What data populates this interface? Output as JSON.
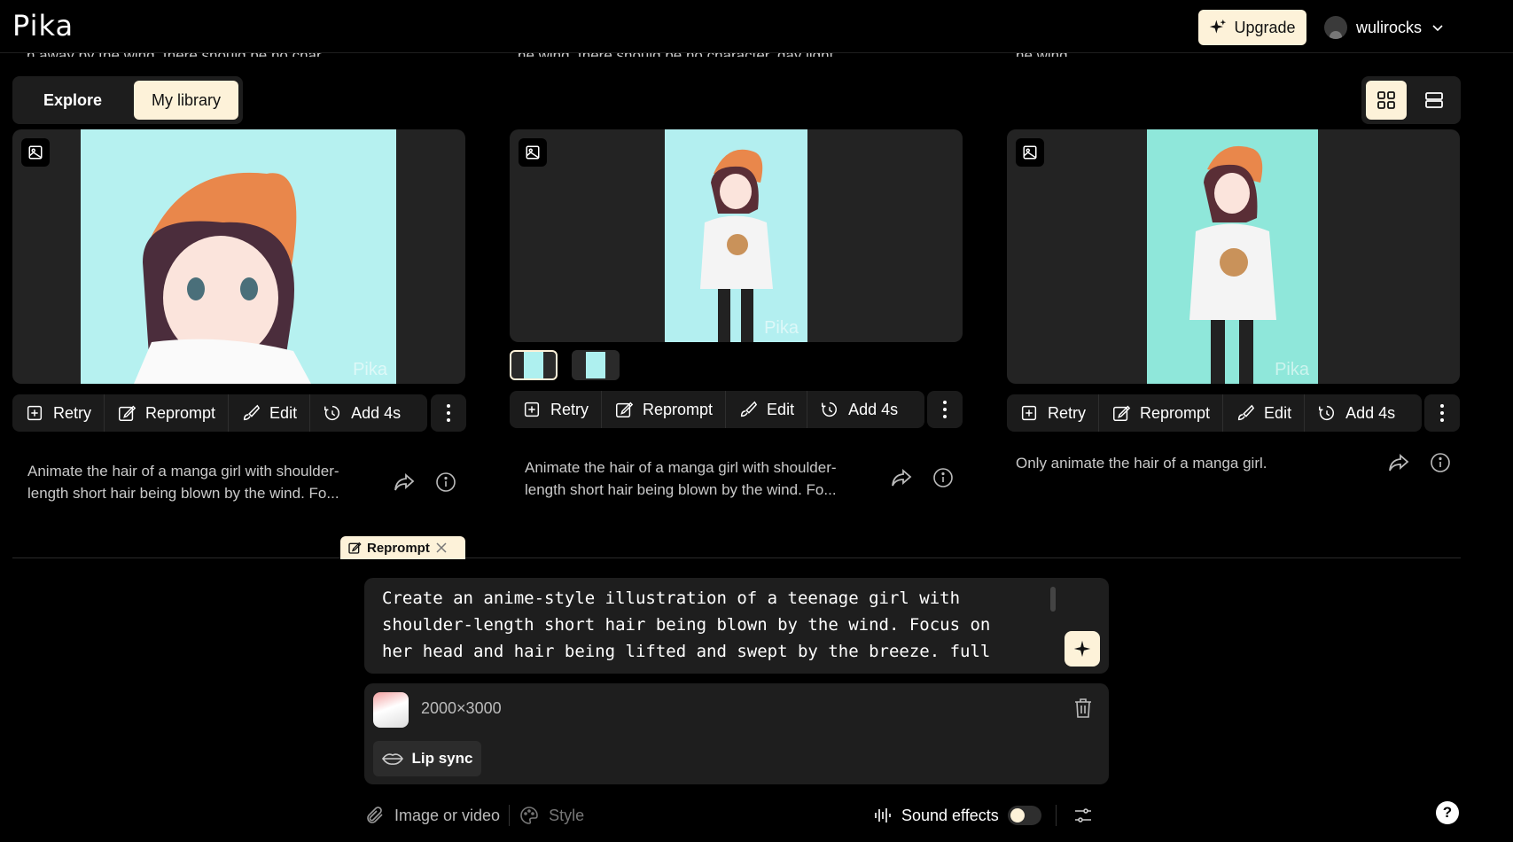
{
  "header": {
    "logo": "Pika",
    "upgrade_label": "Upgrade",
    "username": "wulirocks"
  },
  "cut_prompts": [
    "n away by the wind, there should be no char...",
    "he wind, there should be no character, day light",
    "he wind"
  ],
  "tabs": {
    "explore": "Explore",
    "library": "My library"
  },
  "actions": {
    "retry": "Retry",
    "reprompt": "Reprompt",
    "edit": "Edit",
    "add": "Add 4s"
  },
  "cards": [
    {
      "caption": "Animate the hair of a manga girl with shoulder-length short hair being blown by the wind. Fo...",
      "watermark": "Pika"
    },
    {
      "caption": "Animate the hair of a manga girl with shoulder-length short hair being blown by the wind. Fo...",
      "watermark": "Pika"
    },
    {
      "caption": "Only animate the hair of a manga girl.",
      "watermark": "Pika"
    }
  ],
  "composer": {
    "reprompt_chip": "Reprompt",
    "prompt": "Create an anime-style illustration of a teenage girl with shoulder-length short hair being blown by the wind. Focus on her head and hair  being lifted and swept by the breeze. full",
    "attachment_size": "2000×3000",
    "lip_sync": "Lip sync",
    "image_or_video": "Image or video",
    "style": "Style",
    "sound_effects": "Sound effects",
    "help": "?"
  },
  "colors": {
    "accent": "#fdf2d9",
    "card_bg": "#232323",
    "image_bg": "#aef0ef"
  }
}
